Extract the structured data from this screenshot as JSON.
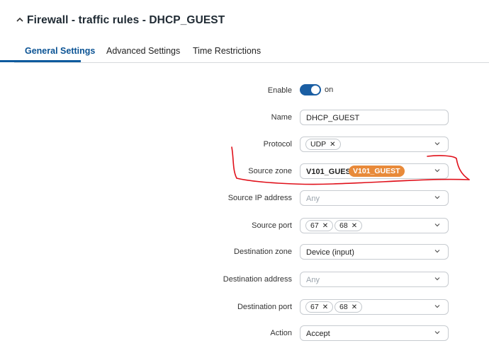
{
  "header": {
    "title": "Firewall - traffic rules - DHCP_GUEST",
    "collapse_icon": "chevron-up-icon"
  },
  "tabs": [
    {
      "label": "General Settings",
      "active": true
    },
    {
      "label": "Advanced Settings",
      "active": false
    },
    {
      "label": "Time Restrictions",
      "active": false
    }
  ],
  "form": {
    "enable": {
      "label": "Enable",
      "state_label": "on",
      "value": true
    },
    "name": {
      "label": "Name",
      "value": "DHCP_GUEST"
    },
    "protocol": {
      "label": "Protocol",
      "chips": [
        "UDP"
      ]
    },
    "source_zone": {
      "label": "Source zone",
      "value": "V101_GUEST:",
      "badge": "V101_GUEST"
    },
    "source_ip": {
      "label": "Source IP address",
      "placeholder": "Any"
    },
    "source_port": {
      "label": "Source port",
      "chips": [
        "67",
        "68"
      ]
    },
    "destination_zone": {
      "label": "Destination zone",
      "value": "Device (input)"
    },
    "destination_address": {
      "label": "Destination address",
      "placeholder": "Any"
    },
    "destination_port": {
      "label": "Destination port",
      "chips": [
        "67",
        "68"
      ]
    },
    "action": {
      "label": "Action",
      "value": "Accept"
    }
  },
  "colors": {
    "accent": "#0d5a9e",
    "toggle_on": "#1a5ea3",
    "zone_badge": "#e88a3a",
    "annotation": "#e0101a"
  },
  "icons": {
    "remove_chip": "close-icon",
    "dropdown": "chevron-down-icon"
  }
}
